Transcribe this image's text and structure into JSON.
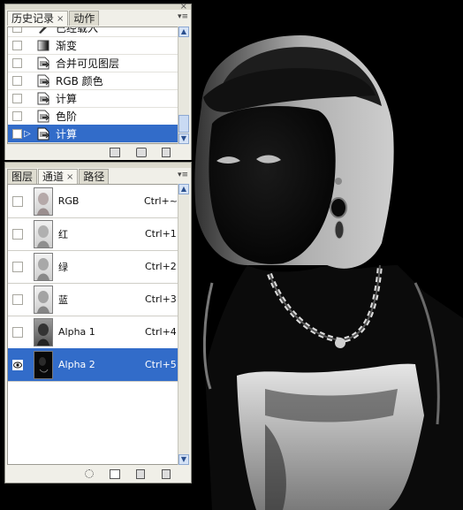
{
  "history_panel": {
    "tabs": [
      {
        "label": "历史记录",
        "close": "×"
      },
      {
        "label": "动作"
      }
    ],
    "items": [
      {
        "label": "已经载入",
        "icon": "brush-icon"
      },
      {
        "label": "渐变",
        "icon": "gradient-icon"
      },
      {
        "label": "合并可见图层",
        "icon": "document-icon"
      },
      {
        "label": "RGB 颜色",
        "icon": "document-icon"
      },
      {
        "label": "计算",
        "icon": "document-icon"
      },
      {
        "label": "色阶",
        "icon": "document-icon"
      },
      {
        "label": "计算",
        "icon": "document-icon",
        "selected": true
      }
    ]
  },
  "channels_panel": {
    "tabs": [
      {
        "label": "图层"
      },
      {
        "label": "通道",
        "close": "×"
      },
      {
        "label": "路径"
      }
    ],
    "channels": [
      {
        "name": "RGB",
        "shortcut": "Ctrl+~",
        "visible": false
      },
      {
        "name": "红",
        "shortcut": "Ctrl+1",
        "visible": false
      },
      {
        "name": "绿",
        "shortcut": "Ctrl+2",
        "visible": false
      },
      {
        "name": "蓝",
        "shortcut": "Ctrl+3",
        "visible": false
      },
      {
        "name": "Alpha 1",
        "shortcut": "Ctrl+4",
        "visible": false
      },
      {
        "name": "Alpha 2",
        "shortcut": "Ctrl+5",
        "visible": true,
        "selected": true
      }
    ]
  },
  "colors": {
    "selection": "#326cc9",
    "panel_bg": "#f0efe8",
    "canvas_bg": "#000000"
  }
}
